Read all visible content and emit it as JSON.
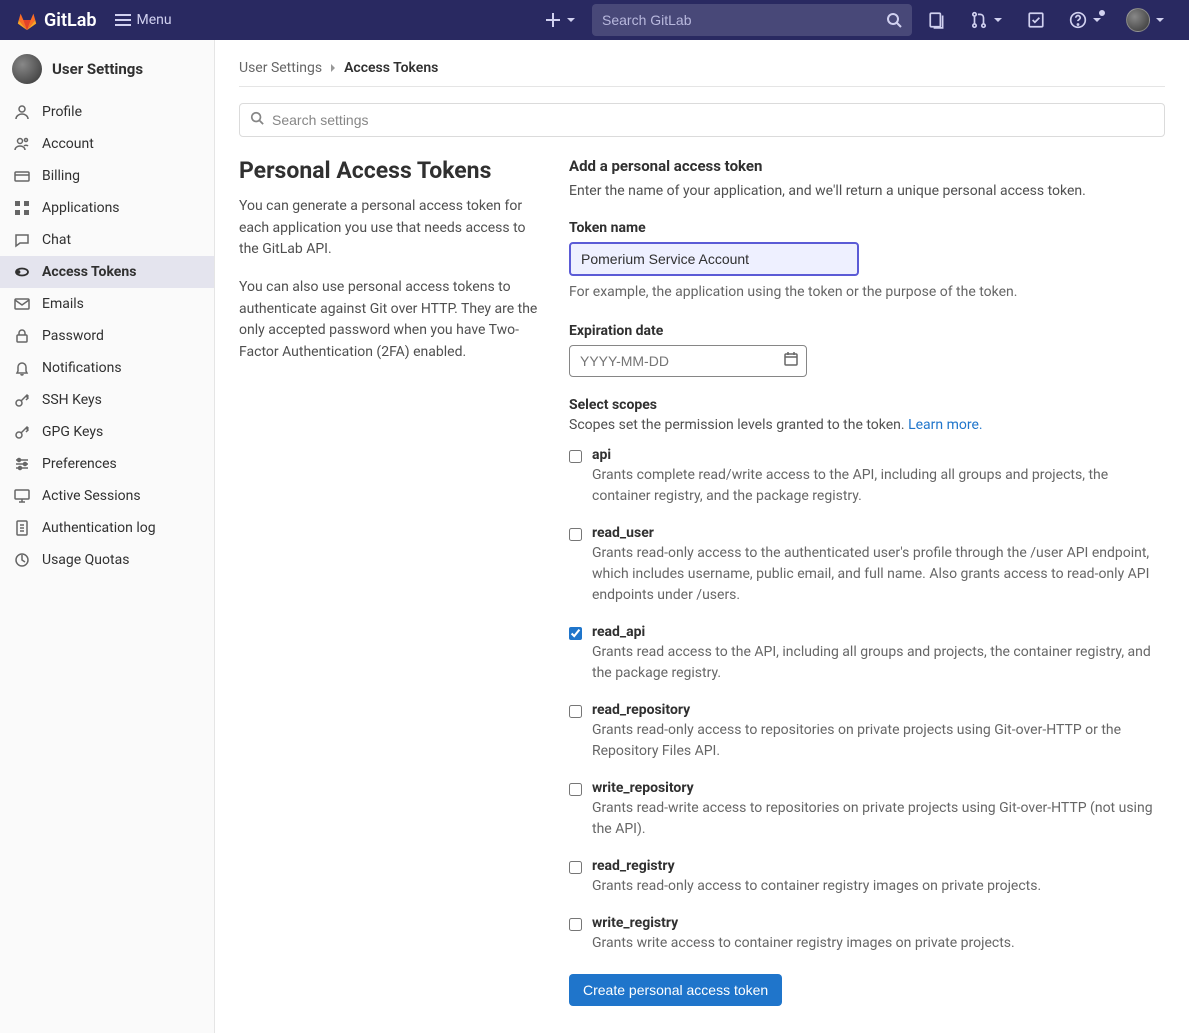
{
  "navbar": {
    "brand": "GitLab",
    "menu_label": "Menu",
    "search_placeholder": "Search GitLab"
  },
  "sidebar": {
    "title": "User Settings",
    "items": [
      {
        "label": "Profile"
      },
      {
        "label": "Account"
      },
      {
        "label": "Billing"
      },
      {
        "label": "Applications"
      },
      {
        "label": "Chat"
      },
      {
        "label": "Access Tokens"
      },
      {
        "label": "Emails"
      },
      {
        "label": "Password"
      },
      {
        "label": "Notifications"
      },
      {
        "label": "SSH Keys"
      },
      {
        "label": "GPG Keys"
      },
      {
        "label": "Preferences"
      },
      {
        "label": "Active Sessions"
      },
      {
        "label": "Authentication log"
      },
      {
        "label": "Usage Quotas"
      }
    ]
  },
  "breadcrumbs": {
    "parent": "User Settings",
    "current": "Access Tokens"
  },
  "settings_search_placeholder": "Search settings",
  "left": {
    "title": "Personal Access Tokens",
    "p1": "You can generate a personal access token for each application you use that needs access to the GitLab API.",
    "p2": "You can also use personal access tokens to authenticate against Git over HTTP. They are the only accepted password when you have Two-Factor Authentication (2FA) enabled."
  },
  "form": {
    "add_head": "Add a personal access token",
    "add_sub": "Enter the name of your application, and we'll return a unique personal access token.",
    "name_label": "Token name",
    "name_value": "Pomerium Service Account",
    "name_help": "For example, the application using the token or the purpose of the token.",
    "exp_label": "Expiration date",
    "exp_placeholder": "YYYY-MM-DD",
    "scopes_label": "Select scopes",
    "scopes_sub": "Scopes set the permission levels granted to the token. ",
    "scopes_link": "Learn more.",
    "submit_label": "Create personal access token"
  },
  "scopes": [
    {
      "name": "api",
      "checked": false,
      "desc": "Grants complete read/write access to the API, including all groups and projects, the container registry, and the package registry."
    },
    {
      "name": "read_user",
      "checked": false,
      "desc": "Grants read-only access to the authenticated user's profile through the /user API endpoint, which includes username, public email, and full name. Also grants access to read-only API endpoints under /users."
    },
    {
      "name": "read_api",
      "checked": true,
      "desc": "Grants read access to the API, including all groups and projects, the container registry, and the package registry."
    },
    {
      "name": "read_repository",
      "checked": false,
      "desc": "Grants read-only access to repositories on private projects using Git-over-HTTP or the Repository Files API."
    },
    {
      "name": "write_repository",
      "checked": false,
      "desc": "Grants read-write access to repositories on private projects using Git-over-HTTP (not using the API)."
    },
    {
      "name": "read_registry",
      "checked": false,
      "desc": "Grants read-only access to container registry images on private projects."
    },
    {
      "name": "write_registry",
      "checked": false,
      "desc": "Grants write access to container registry images on private projects."
    }
  ]
}
